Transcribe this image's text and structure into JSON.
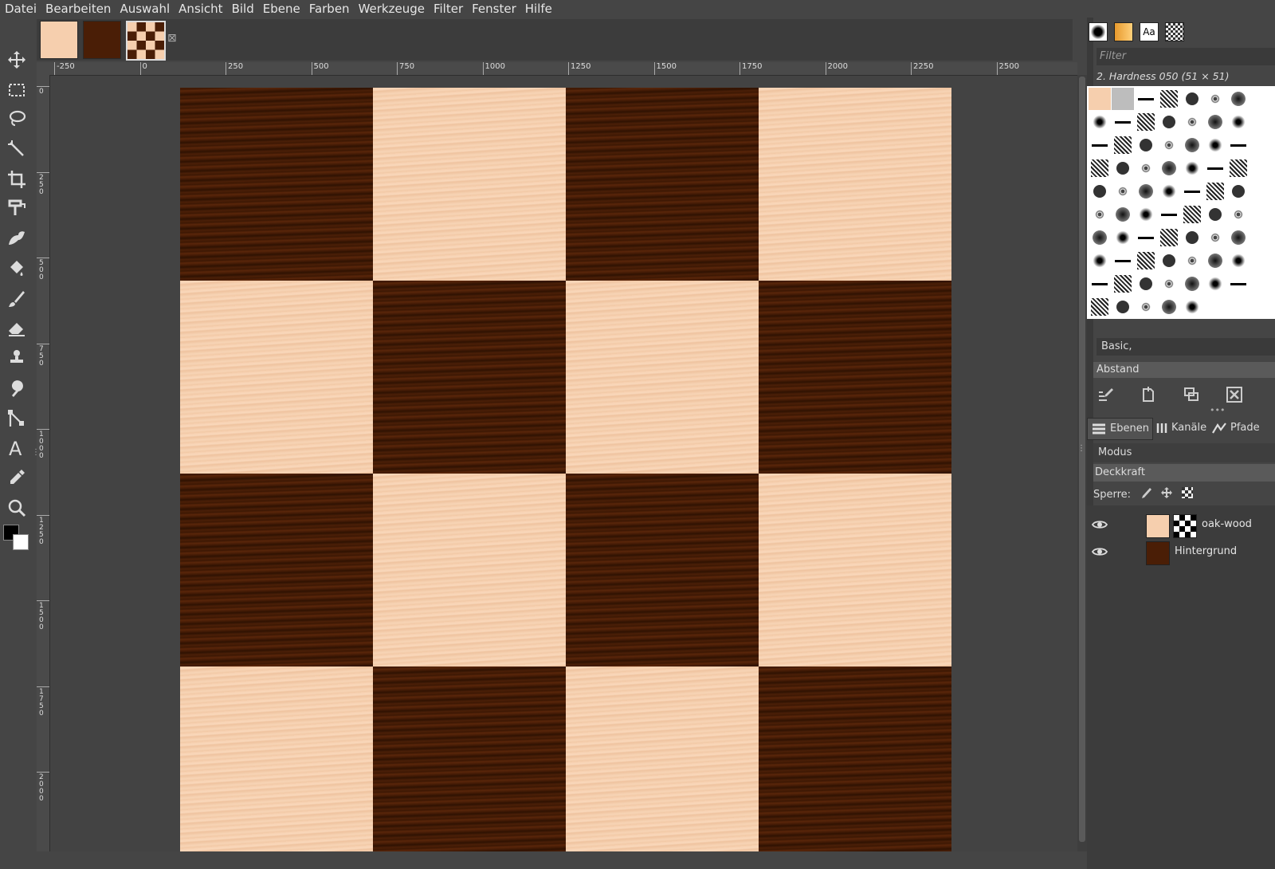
{
  "menu": [
    "Datei",
    "Bearbeiten",
    "Auswahl",
    "Ansicht",
    "Bild",
    "Ebene",
    "Farben",
    "Werkzeuge",
    "Filter",
    "Fenster",
    "Hilfe"
  ],
  "image_tabs": {
    "close_glyph": "⊠"
  },
  "ruler": {
    "h_labels": [
      "-250",
      "0",
      "250",
      "500",
      "750",
      "1000",
      "1250",
      "1500",
      "1750",
      "2000",
      "2250",
      "2500"
    ],
    "v_labels": [
      "0",
      "250",
      "500",
      "750",
      "1000",
      "1250",
      "1500",
      "1750",
      "2000"
    ]
  },
  "canvas": {
    "board_colors": {
      "light": "#f6cfae",
      "dark": "#4a1e06"
    },
    "pattern": [
      "dark",
      "light",
      "dark",
      "light",
      "light",
      "dark",
      "light",
      "dark",
      "dark",
      "light",
      "dark",
      "light",
      "light",
      "dark",
      "light",
      "dark"
    ]
  },
  "dock": {
    "filter_placeholder": "Filter",
    "brush_name": "2. Hardness 050 (51 × 51)",
    "preset": "Basic,",
    "spacing_label": "Abstand",
    "tabs": {
      "layers": "Ebenen",
      "channels": "Kanäle",
      "paths": "Pfade"
    },
    "modus_label": "Modus",
    "opacity_label": "Deckkraft",
    "lock_label": "Sperre:",
    "layers": [
      {
        "name": "oak-wood",
        "visible": true
      },
      {
        "name": "Hintergrund",
        "visible": true
      }
    ]
  }
}
